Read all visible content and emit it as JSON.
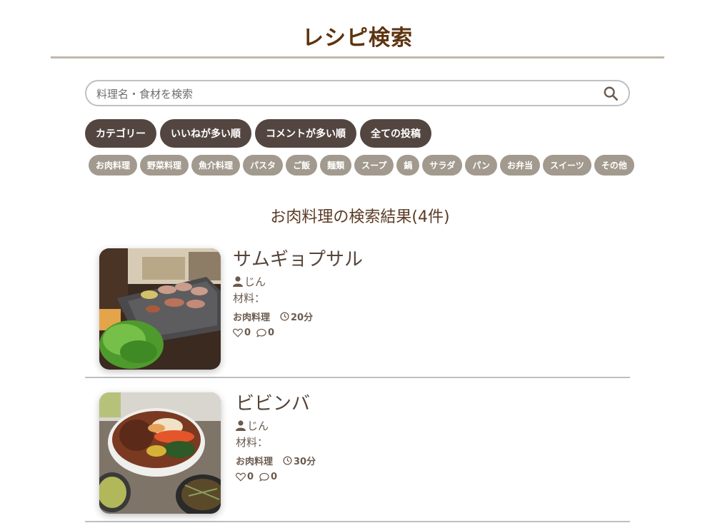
{
  "header": {
    "title": "レシピ検索"
  },
  "search": {
    "placeholder": "料理名・食材を検索",
    "icon": "search-icon"
  },
  "sort_buttons": [
    "カテゴリー",
    "いいねが多い順",
    "コメントが多い順",
    "全ての投稿"
  ],
  "categories": [
    "お肉料理",
    "野菜料理",
    "魚介料理",
    "パスタ",
    "ご飯",
    "麺類",
    "スープ",
    "鍋",
    "サラダ",
    "パン",
    "お弁当",
    "スイーツ",
    "その他"
  ],
  "results": {
    "title": "お肉料理の検索結果(4件)",
    "items": [
      {
        "name": "サムギョプサル",
        "author": "じん",
        "ingredients_label": "材料：",
        "category": "お肉料理",
        "time": "20分",
        "likes": "0",
        "comments": "0"
      },
      {
        "name": "ビビンバ",
        "author": "じん",
        "ingredients_label": "材料：",
        "category": "お肉料理",
        "time": "30分",
        "likes": "0",
        "comments": "0"
      }
    ]
  },
  "colors": {
    "title": "#5d3410",
    "sort_button_bg": "#534640",
    "category_button_bg": "#a29a8e",
    "divider": "#c2b8ab"
  }
}
